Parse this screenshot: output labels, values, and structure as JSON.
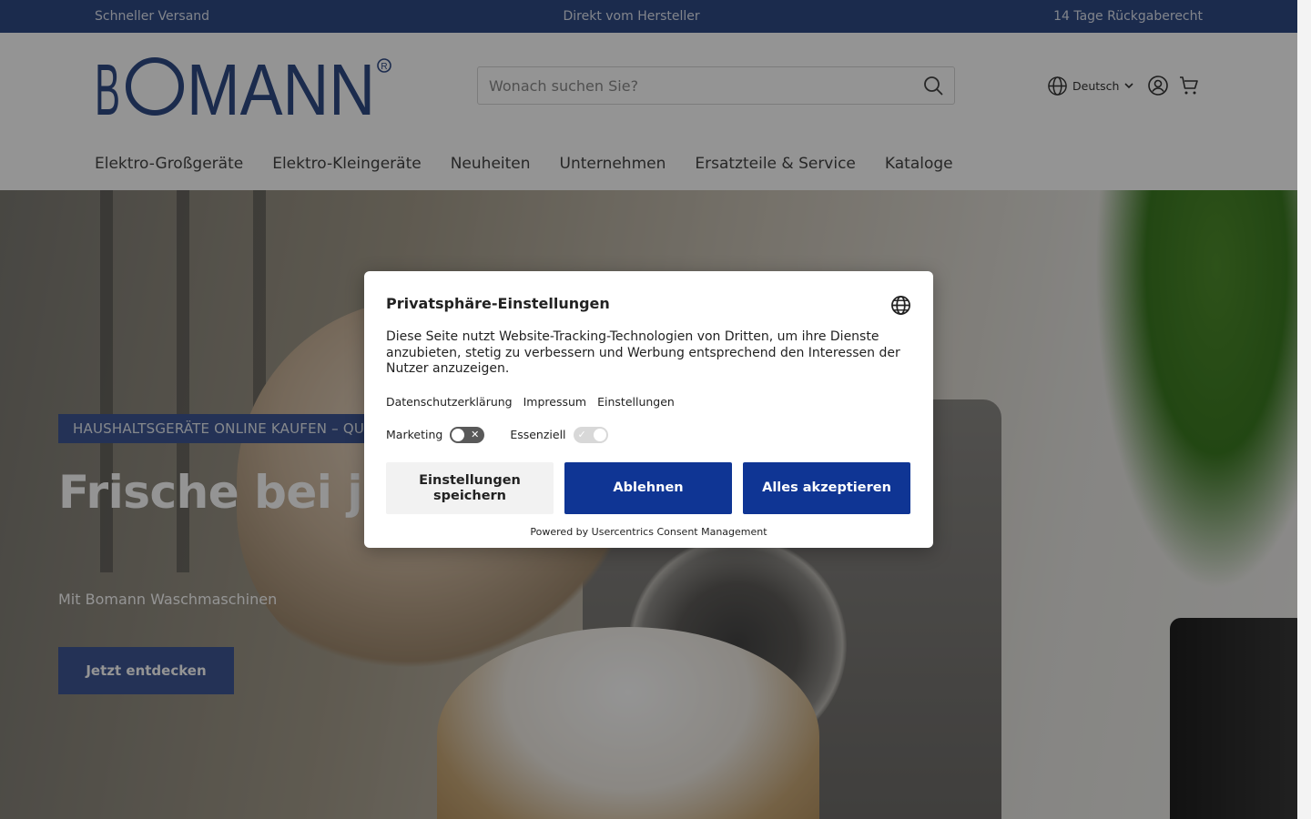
{
  "topbar": {
    "left": "Schneller Versand",
    "center": "Direkt vom Hersteller",
    "right": "14 Tage Rückgaberecht"
  },
  "header": {
    "logo_text": "BOMANN",
    "search_placeholder": "Wonach suchen Sie?",
    "language": "Deutsch",
    "icons": [
      "search-icon",
      "globe-icon",
      "chevron-down-icon",
      "account-icon",
      "cart-icon"
    ]
  },
  "nav": {
    "items": [
      "Elektro-Großgeräte",
      "Elektro-Kleingeräte",
      "Neuheiten",
      "Unternehmen",
      "Ersatzteile & Service",
      "Kataloge"
    ]
  },
  "hero": {
    "tagline": "HAUSHALTSGERÄTE ONLINE KAUFEN – QUA",
    "headline": "Frische bei jedem Tragen",
    "subline": "Mit Bomann Waschmaschinen",
    "cta": "Jetzt entdecken"
  },
  "consent": {
    "title": "Privatsphäre-Einstellungen",
    "body": "Diese Seite nutzt Website-Tracking-Technologien von Dritten, um ihre Dienste anzubieten, stetig zu verbessern und Werbung entsprechend den Interessen der Nutzer anzuzeigen.",
    "links": [
      "Datenschutzerklärung",
      "Impressum",
      "Einstellungen"
    ],
    "toggles": [
      {
        "label": "Marketing",
        "state": "off"
      },
      {
        "label": "Essenziell",
        "state": "on"
      }
    ],
    "buttons": {
      "save": "Einstellungen speichern",
      "deny": "Ablehnen",
      "accept": "Alles akzeptieren"
    },
    "powered_by": "Powered by Usercentrics Consent Management"
  },
  "colors": {
    "brand_blue": "#2f4a86",
    "button_blue": "#0f3594",
    "hero_accent": "#3e5794"
  }
}
